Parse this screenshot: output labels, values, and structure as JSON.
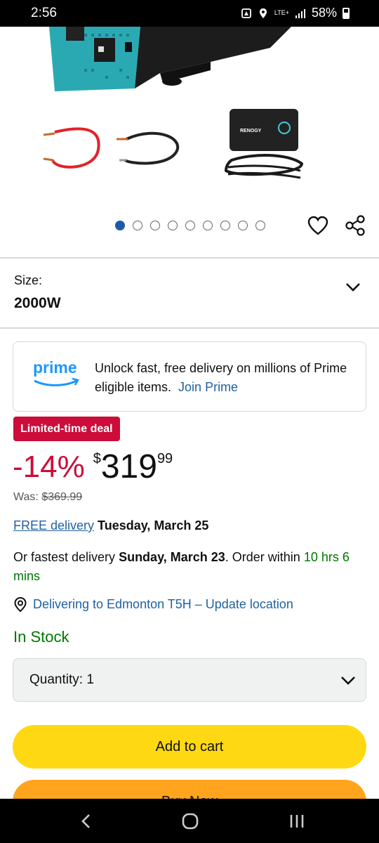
{
  "status_bar": {
    "time": "2:56",
    "network": "LTE+",
    "battery": "58%"
  },
  "gallery": {
    "brand_label": "RENOGY",
    "dots_count": 9,
    "active_dot": 0,
    "wishlist_icon": "heart-icon",
    "share_icon": "share-icon"
  },
  "size": {
    "label": "Size:",
    "value": "2000W"
  },
  "prime": {
    "logo_text": "prime",
    "message": "Unlock fast, free delivery on millions of Prime eligible items.",
    "join_label": "Join Prime"
  },
  "deal": {
    "badge": "Limited-time deal",
    "discount": "-14%",
    "currency": "$",
    "price_whole": "319",
    "price_fraction": "99",
    "was_label": "Was:",
    "was_price": "$369.99"
  },
  "delivery": {
    "free_label": "FREE delivery",
    "free_date": "Tuesday, March 25",
    "fastest_prefix": "Or fastest delivery",
    "fastest_date": "Sunday, March 23",
    "order_within_prefix": ". Order within",
    "order_within_time": "10 hrs 6 mins",
    "location_text": "Delivering to Edmonton T5H – Update location"
  },
  "stock": {
    "status": "In Stock"
  },
  "quantity": {
    "label": "Quantity:",
    "value": "1"
  },
  "buttons": {
    "add_to_cart": "Add to cart",
    "buy_now": "Buy Now"
  },
  "colors": {
    "deal_red": "#cc0c39",
    "link_blue": "#2162a1",
    "stock_green": "#007600",
    "cart_yellow": "#ffd814",
    "buy_orange": "#ffa41c"
  }
}
